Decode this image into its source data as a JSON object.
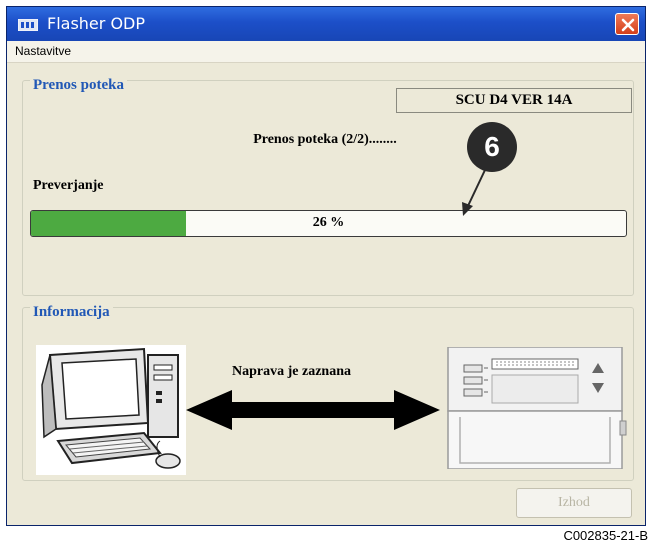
{
  "window": {
    "title": "Flasher ODP",
    "icons": {
      "app": "flasher-app-icon",
      "close": "close-icon"
    }
  },
  "menu": {
    "items": [
      "Nastavitve"
    ]
  },
  "transfer_group": {
    "title": "Prenos poteka",
    "device_id": "SCU D4 VER 14A",
    "status": "Prenos poteka (2/2)........",
    "verify_label": "Preverjanje",
    "progress": {
      "fraction": 0.26,
      "text": "26 %",
      "fill_color": "#4daa41"
    }
  },
  "callout": {
    "number": "6"
  },
  "info_group": {
    "title": "Informacija",
    "device_status": "Naprava je zaznana",
    "images": [
      "computer-illustration",
      "double-arrow-icon",
      "control-panel-device-illustration"
    ]
  },
  "footer": {
    "exit_label": "Izhod"
  },
  "caption": "C002835-21-B",
  "colors": {
    "titlebar": "#1c4fc8",
    "group_title": "#2158b6",
    "window_bg": "#ece9d8"
  }
}
